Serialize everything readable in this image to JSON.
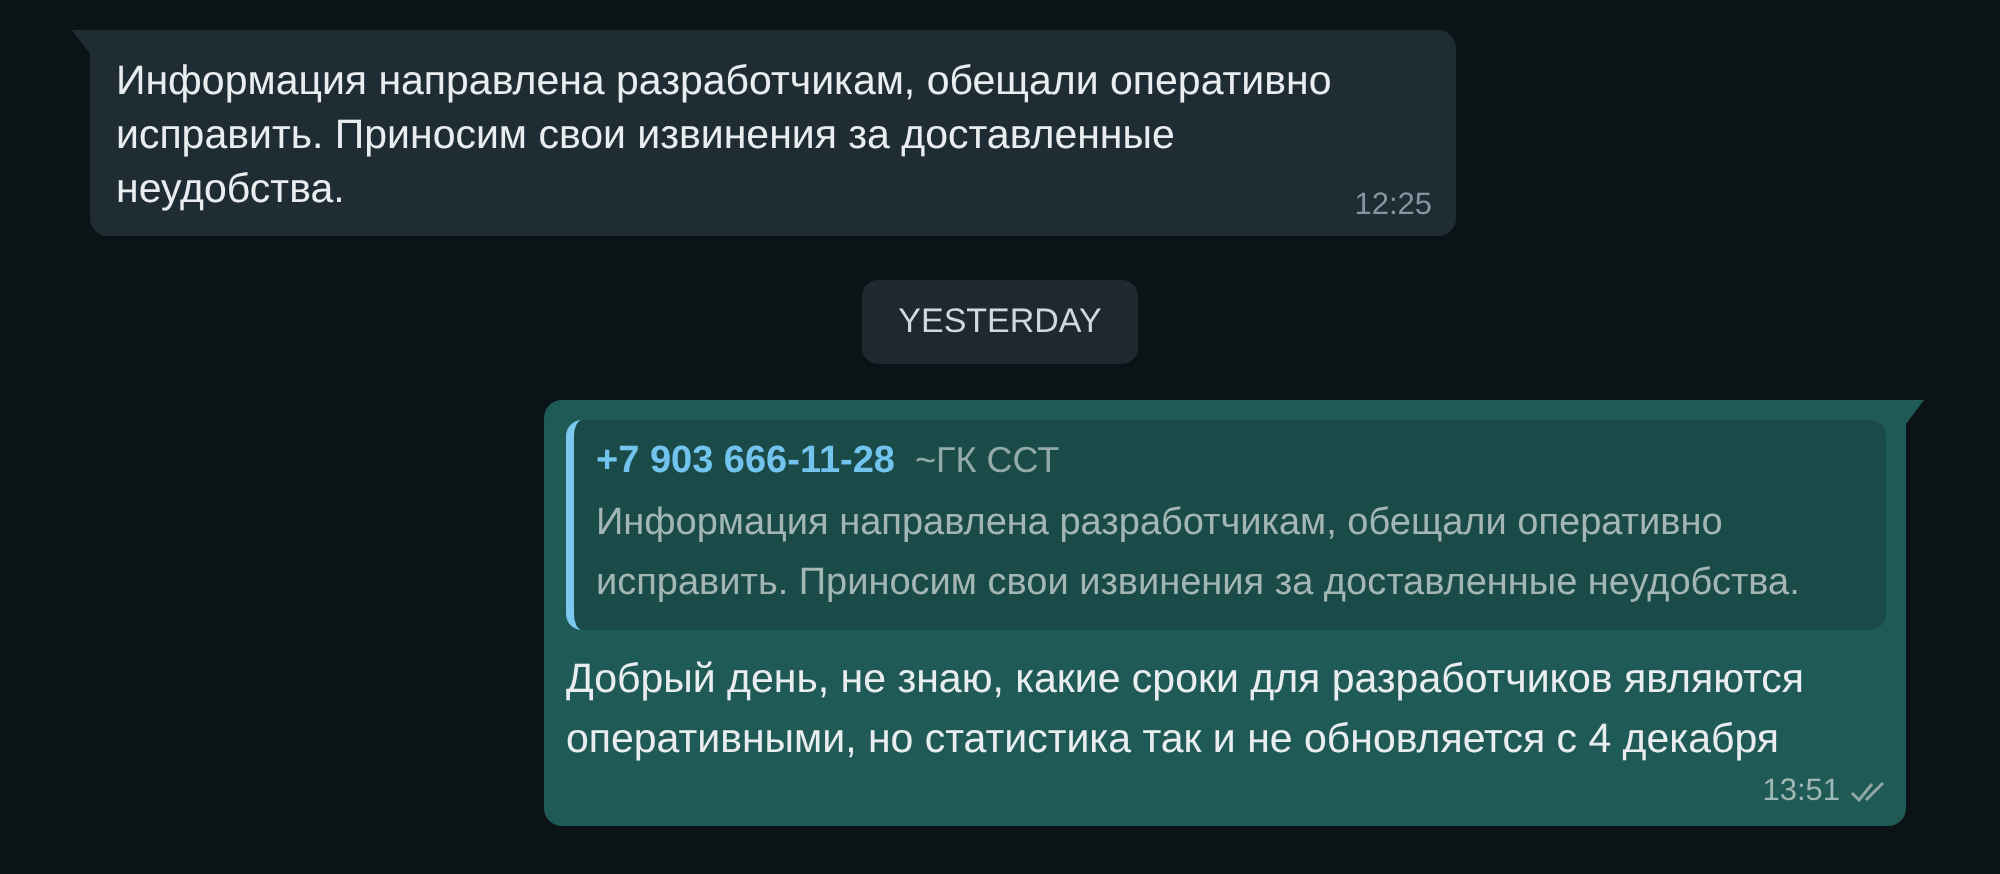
{
  "messages": [
    {
      "kind": "incoming",
      "text": "Информация направлена разработчикам, обещали оперативно исправить. Приносим свои извинения за доставленные неудобства.",
      "time": "12:25"
    },
    {
      "kind": "date",
      "text": "YESTERDAY"
    },
    {
      "kind": "outgoing",
      "quote": {
        "author": "+7 903 666-11-28",
        "group": "~ГК ССТ",
        "text": "Информация направлена разработчикам, обещали оперативно исправить. Приносим свои извинения за доставленные неудобства."
      },
      "text": "Добрый день, не знаю, какие сроки для разработчиков являются оперативными, но статистика так и не обновляется с 4 декабря",
      "time": "13:51",
      "read": false
    }
  ]
}
